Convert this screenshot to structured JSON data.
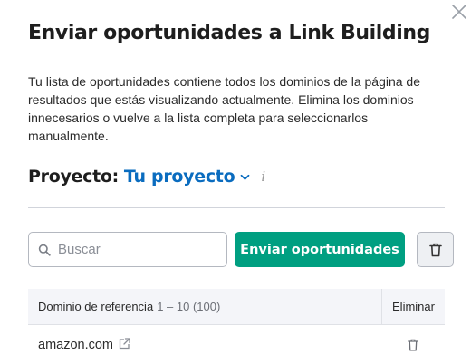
{
  "dialog": {
    "title": "Enviar oportunidades a Link Building",
    "description": "Tu lista de oportunidades contiene todos los dominios de la página de resultados que estás visualizando actualmente. Elimina los dominios innecesarios o vuelve a la lista completa para seleccionarlos manualmente.",
    "close_icon": "close-icon"
  },
  "project": {
    "label": "Proyecto:",
    "value": "Tu proyecto",
    "info_glyph": "i"
  },
  "toolbar": {
    "search_placeholder": "Buscar",
    "send_label": "Enviar oportunidades"
  },
  "table": {
    "columns": {
      "domain": "Dominio de referencia",
      "range": "1 – 10 (100)",
      "delete": "Eliminar"
    },
    "rows": [
      {
        "domain": "amazon.com"
      }
    ]
  },
  "colors": {
    "primary_green": "#009f81",
    "link_blue": "#0a6cbf"
  }
}
